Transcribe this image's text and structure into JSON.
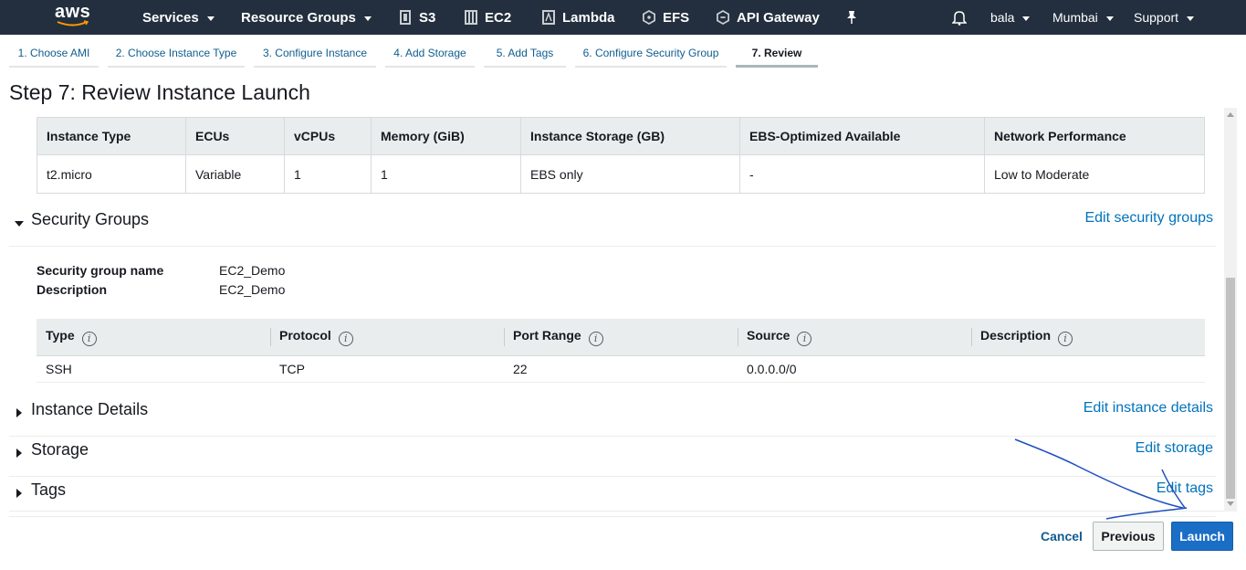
{
  "nav": {
    "logo": "aws",
    "services": "Services",
    "resource_groups": "Resource Groups",
    "s3": "S3",
    "ec2": "EC2",
    "lambda": "Lambda",
    "efs": "EFS",
    "api_gateway": "API Gateway",
    "user": "bala",
    "region": "Mumbai",
    "support": "Support",
    "bar_color": "#232f3e"
  },
  "wizard": {
    "tabs": [
      "1. Choose AMI",
      "2. Choose Instance Type",
      "3. Configure Instance",
      "4. Add Storage",
      "5. Add Tags",
      "6. Configure Security Group",
      "7. Review"
    ],
    "active_index": 6
  },
  "page": {
    "title": "Step 7: Review Instance Launch"
  },
  "instance_type_table": {
    "headers": [
      "Instance Type",
      "ECUs",
      "vCPUs",
      "Memory (GiB)",
      "Instance Storage (GB)",
      "EBS-Optimized Available",
      "Network Performance"
    ],
    "row": [
      "t2.micro",
      "Variable",
      "1",
      "1",
      "EBS only",
      "-",
      "Low to Moderate"
    ]
  },
  "security_groups": {
    "title": "Security Groups",
    "edit_link": "Edit security groups",
    "name_label": "Security group name",
    "name_value": "EC2_Demo",
    "desc_label": "Description",
    "desc_value": "EC2_Demo",
    "rules_headers": [
      "Type",
      "Protocol",
      "Port Range",
      "Source",
      "Description"
    ],
    "rules_row": [
      "SSH",
      "TCP",
      "22",
      "0.0.0.0/0",
      ""
    ]
  },
  "instance_details": {
    "title": "Instance Details",
    "edit_link": "Edit instance details"
  },
  "storage": {
    "title": "Storage",
    "edit_link": "Edit storage"
  },
  "tags": {
    "title": "Tags",
    "edit_link": "Edit tags"
  },
  "footer": {
    "cancel": "Cancel",
    "previous": "Previous",
    "launch": "Launch",
    "launch_color": "#1a6ec6"
  },
  "icons": {
    "notifications": "bell-icon",
    "pin": "pin-icon",
    "info": "info-icon"
  }
}
